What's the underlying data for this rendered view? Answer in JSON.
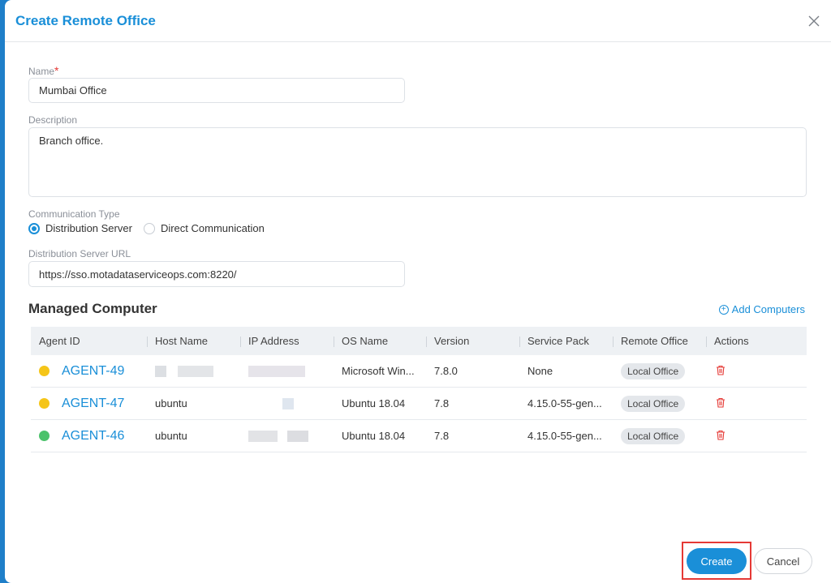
{
  "dialog": {
    "title": "Create Remote Office"
  },
  "form": {
    "name_label": "Name",
    "name_required_mark": "*",
    "name_value": "Mumbai Office",
    "description_label": "Description",
    "description_value": "Branch office.",
    "comm_type_label": "Communication Type",
    "comm_options": [
      {
        "label": "Distribution Server",
        "selected": true
      },
      {
        "label": "Direct Communication",
        "selected": false
      }
    ],
    "dist_url_label": "Distribution Server URL",
    "dist_url_value": "https://sso.motadataserviceops.com:8220/"
  },
  "managed": {
    "title": "Managed Computer",
    "add_label": "Add Computers",
    "columns": [
      "Agent ID",
      "Host Name",
      "IP Address",
      "OS Name",
      "Version",
      "Service Pack",
      "Remote Office",
      "Actions"
    ],
    "rows": [
      {
        "status_color": "#f5c518",
        "agent_id": "AGENT-49",
        "host_name": "",
        "ip_address": "",
        "os_name": "Microsoft Win...",
        "version": "7.8.0",
        "service_pack": "None",
        "remote_office": "Local Office"
      },
      {
        "status_color": "#f5c518",
        "agent_id": "AGENT-47",
        "host_name": "ubuntu",
        "ip_address": "",
        "os_name": "Ubuntu 18.04",
        "version": "7.8",
        "service_pack": "4.15.0-55-gen...",
        "remote_office": "Local Office"
      },
      {
        "status_color": "#4cc26b",
        "agent_id": "AGENT-46",
        "host_name": "ubuntu",
        "ip_address": "",
        "os_name": "Ubuntu 18.04",
        "version": "7.8",
        "service_pack": "4.15.0-55-gen...",
        "remote_office": "Local Office"
      }
    ]
  },
  "footer": {
    "create_label": "Create",
    "cancel_label": "Cancel"
  },
  "colors": {
    "accent": "#1a8fd8",
    "danger": "#e53935",
    "highlight": "#e53935"
  }
}
